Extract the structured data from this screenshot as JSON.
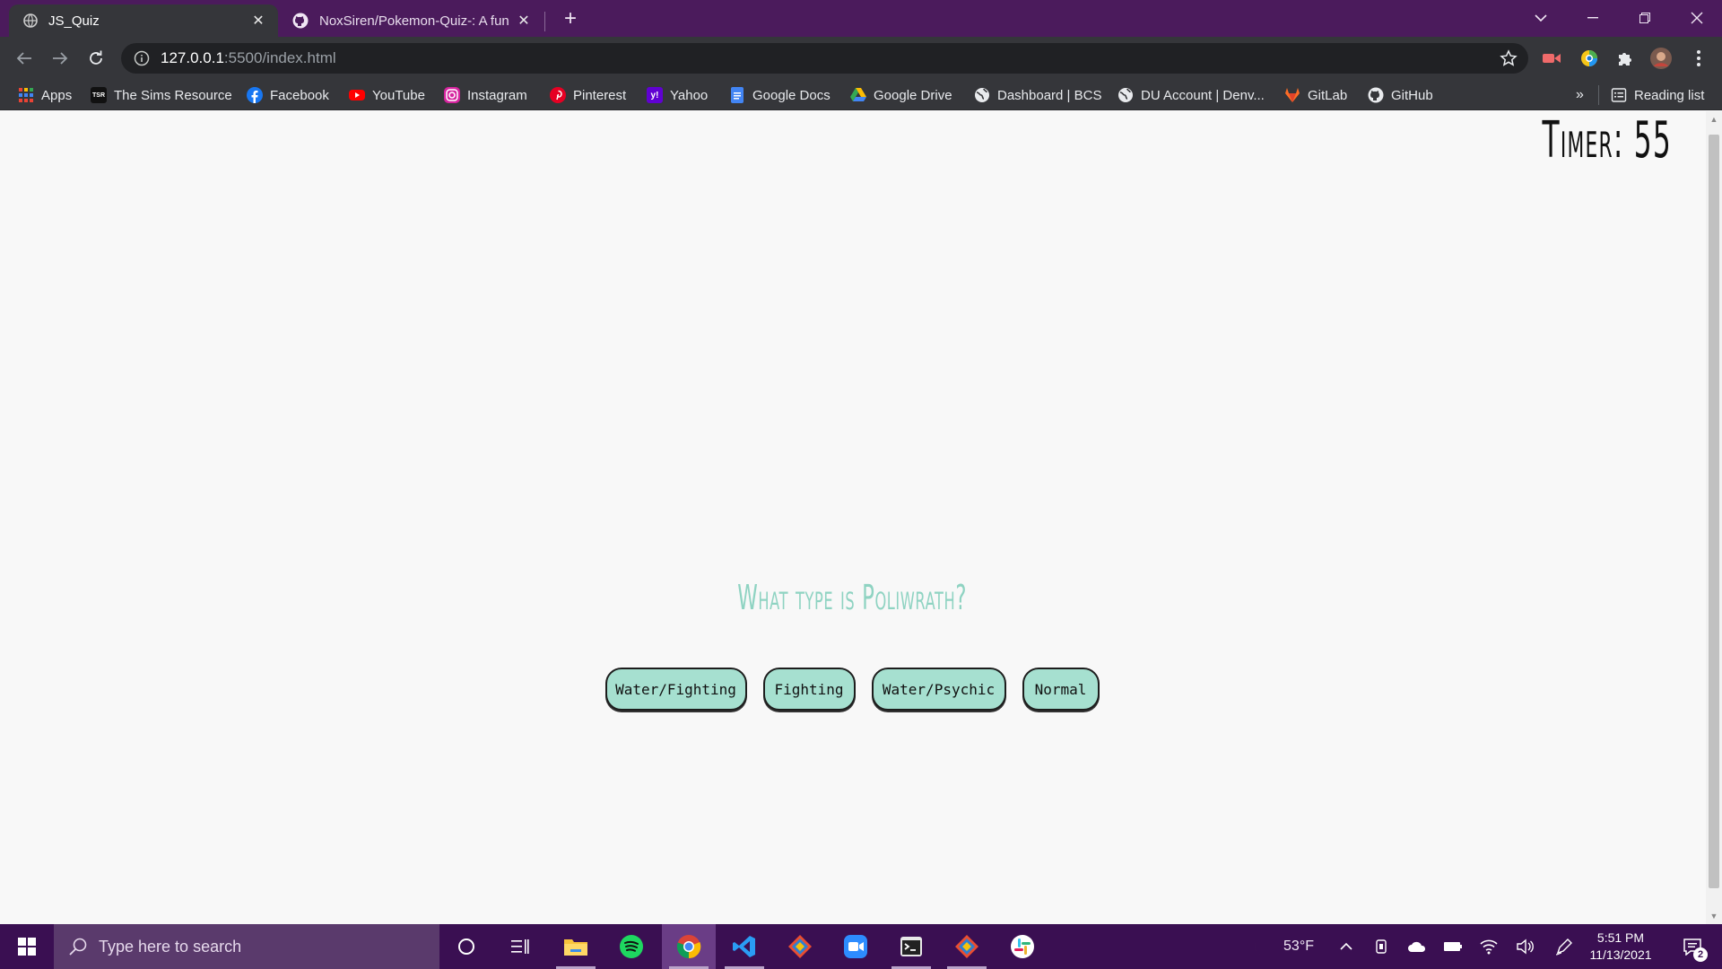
{
  "browser": {
    "tabs": [
      {
        "title": "JS_Quiz",
        "active": true
      },
      {
        "title": "NoxSiren/Pokemon-Quiz-: A fun",
        "active": false
      }
    ],
    "new_tab": "+",
    "url_host": "127.0.0.1",
    "url_path": ":5500/index.html",
    "bookmarks": [
      {
        "label": "Apps",
        "icon": "apps-grid-icon"
      },
      {
        "label": "The Sims Resource",
        "icon": "tsr-icon"
      },
      {
        "label": "Facebook",
        "icon": "facebook-icon"
      },
      {
        "label": "YouTube",
        "icon": "youtube-icon"
      },
      {
        "label": "Instagram",
        "icon": "instagram-icon"
      },
      {
        "label": "Pinterest",
        "icon": "pinterest-icon"
      },
      {
        "label": "Yahoo",
        "icon": "yahoo-icon"
      },
      {
        "label": "Google Docs",
        "icon": "google-docs-icon"
      },
      {
        "label": "Google Drive",
        "icon": "google-drive-icon"
      },
      {
        "label": "Dashboard | BCS",
        "icon": "globe-icon"
      },
      {
        "label": "DU Account | Denv...",
        "icon": "globe-icon"
      },
      {
        "label": "GitLab",
        "icon": "gitlab-icon"
      },
      {
        "label": "GitHub",
        "icon": "github-icon"
      }
    ],
    "more_bookmarks": "»",
    "reading_list": "Reading list",
    "bookmark_icons": {
      "tsr": "TSR",
      "yahoo": "y!"
    }
  },
  "quiz": {
    "timer_text": "Timer: 55",
    "question": "What type is Poliwrath?",
    "answers": [
      "Water/Fighting",
      "Fighting",
      "Water/Psychic",
      "Normal"
    ]
  },
  "taskbar": {
    "search_placeholder": "Type here to search",
    "weather": "53°F",
    "time": "5:51 PM",
    "date": "11/13/2021",
    "notification_count": "2"
  },
  "colors": {
    "titlebar": "#4b1b5c",
    "toolbar": "#35363a",
    "question": "#8fd3c2",
    "answer_bg": "#a6e0d0",
    "taskbar": "#3a0f52"
  }
}
